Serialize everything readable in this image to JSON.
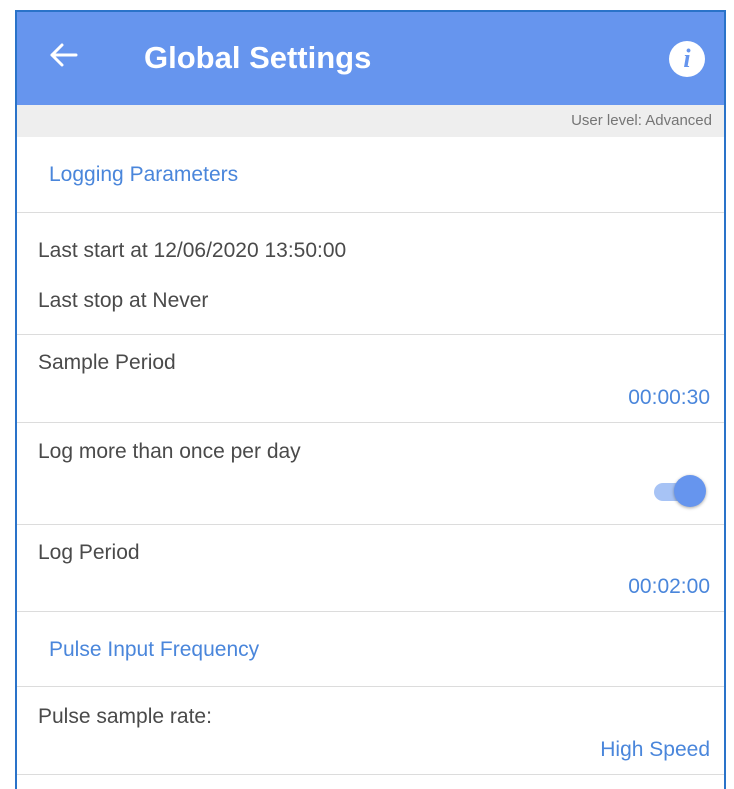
{
  "appbar": {
    "title": "Global Settings",
    "back_icon": "arrow-left-icon",
    "info_icon": "info-icon",
    "color": "#6695ee"
  },
  "user_level": "User level: Advanced",
  "sections": {
    "logging": {
      "title": "Logging Parameters",
      "last_start": "Last start at 12/06/2020 13:50:00",
      "last_stop": "Last stop at Never",
      "sample_period": {
        "label": "Sample Period",
        "value": "00:00:30"
      },
      "log_more": {
        "label": "Log more than once per day",
        "toggle_on": true
      },
      "log_period": {
        "label": "Log Period",
        "value": "00:02:00"
      }
    },
    "pulse": {
      "title": "Pulse Input Frequency",
      "sample_rate": {
        "label": "Pulse sample rate:",
        "value": "High Speed"
      }
    }
  },
  "accent_color": "#4a86db"
}
